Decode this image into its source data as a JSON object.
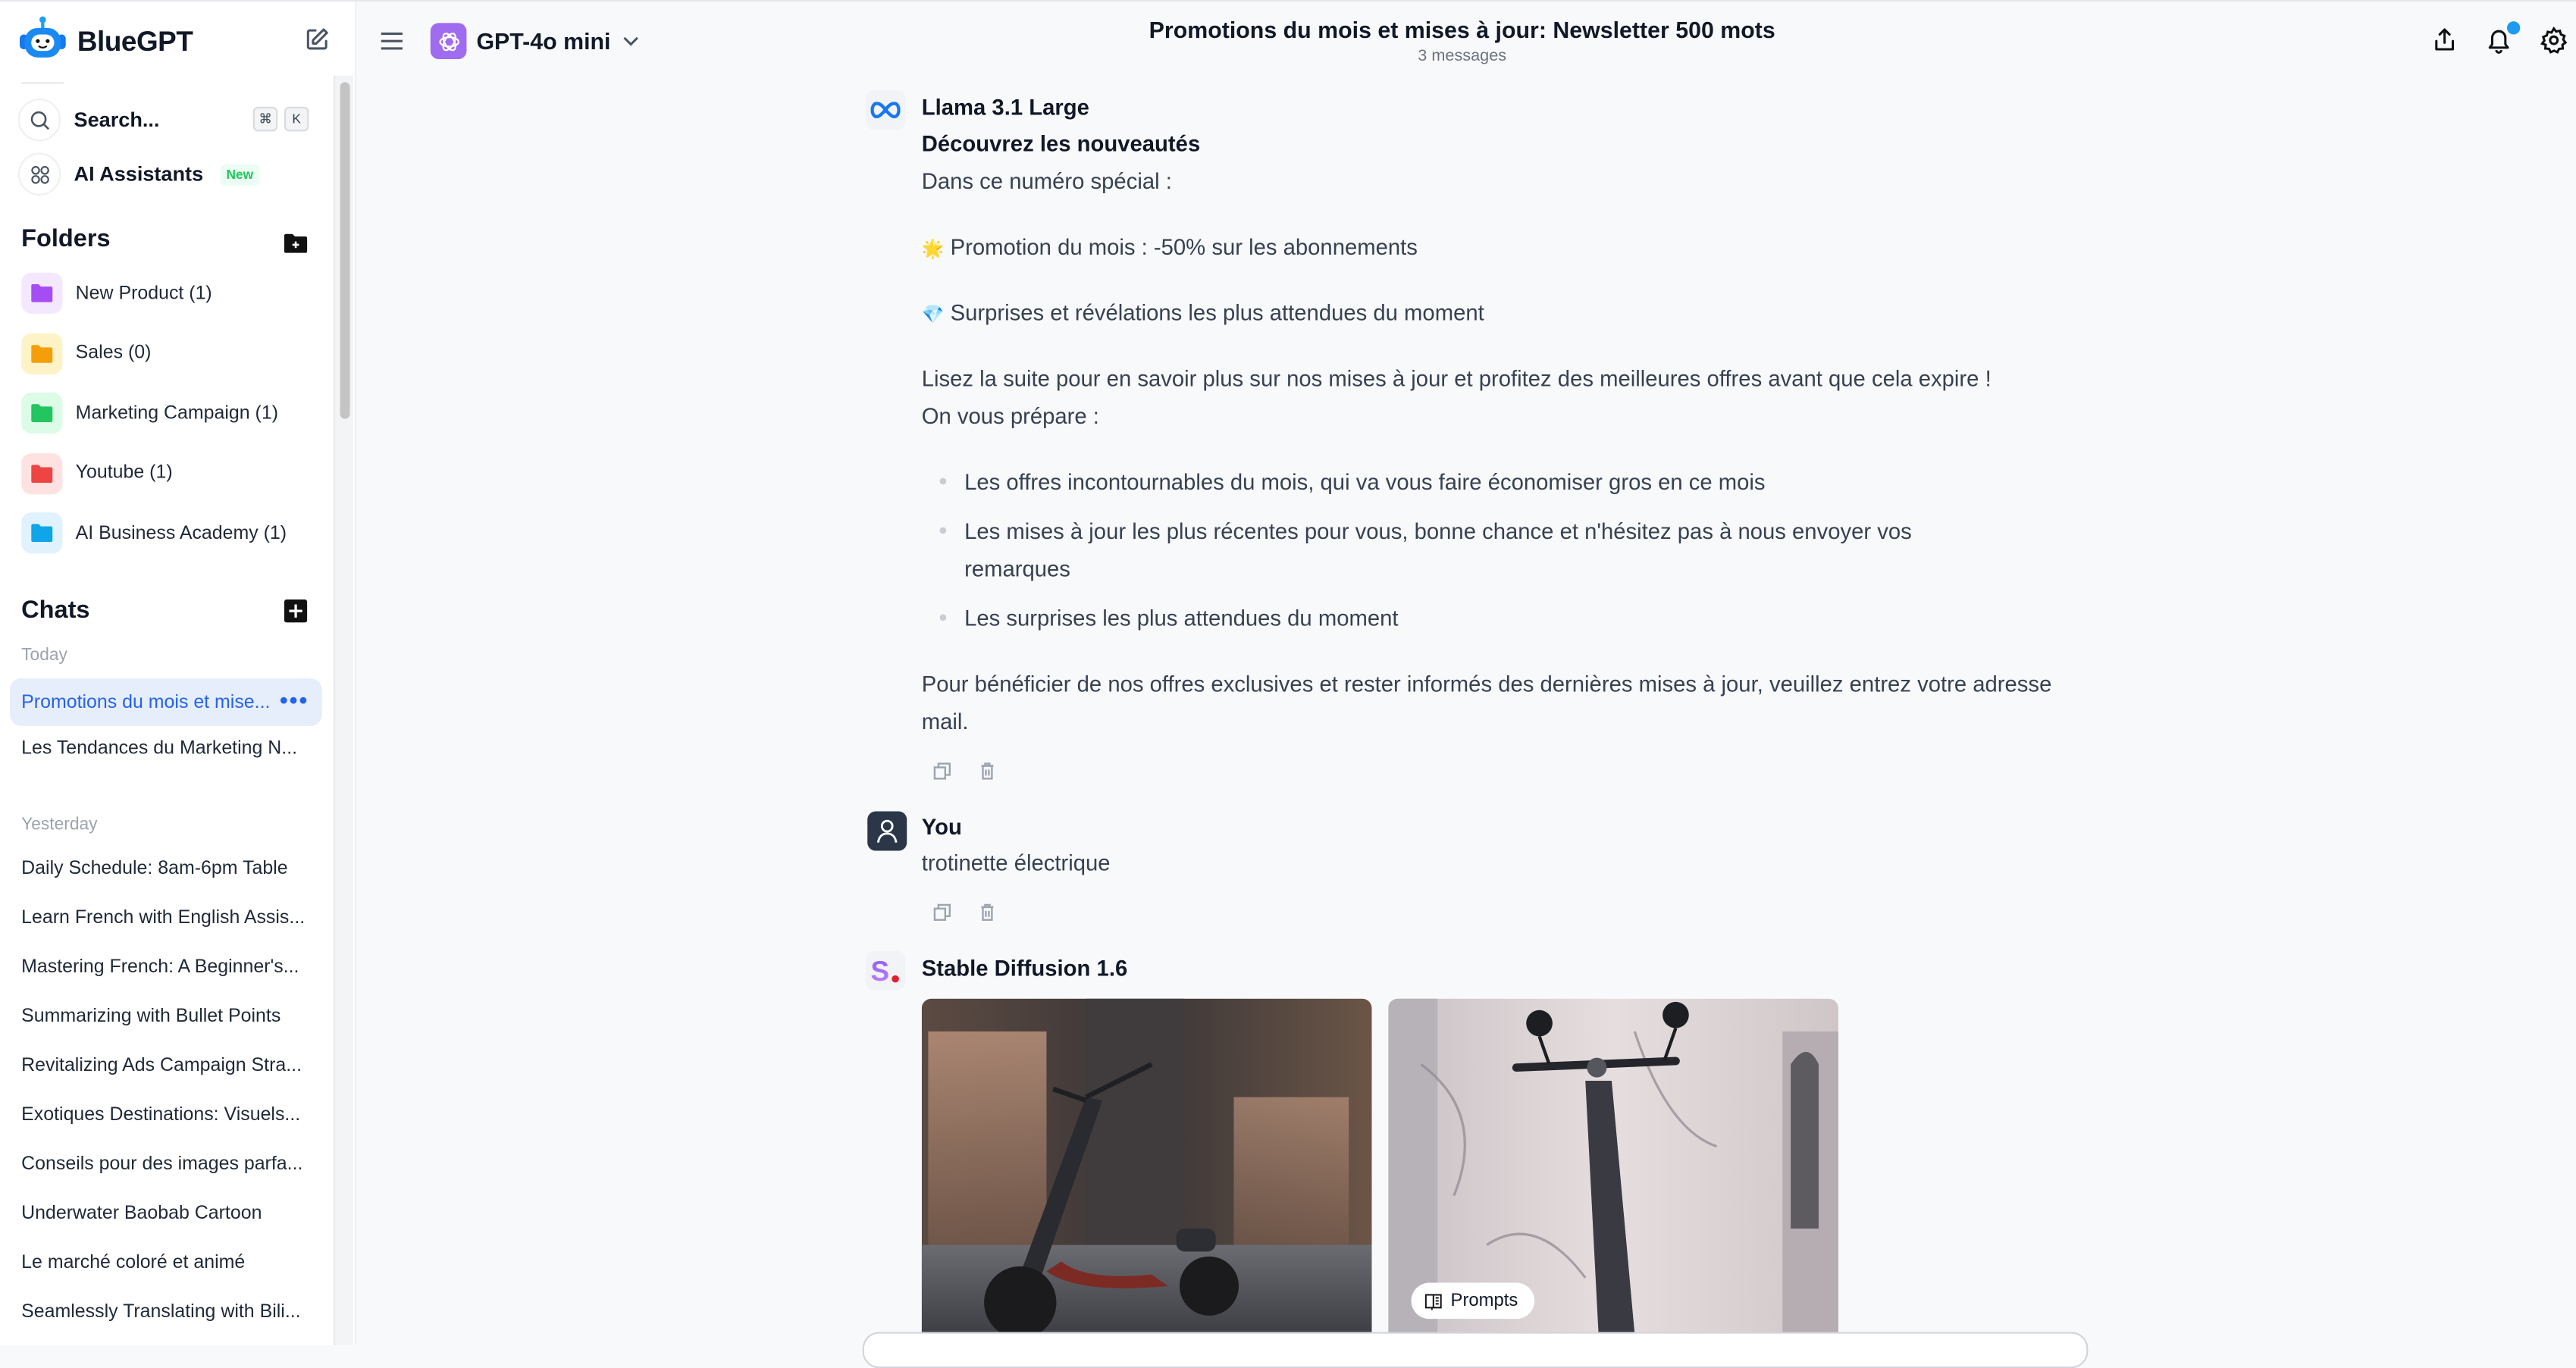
{
  "app": {
    "name": "BlueGPT",
    "logo_icon": "robot-head-icon",
    "new_chat_icon": "edit-icon"
  },
  "sidebar": {
    "search": {
      "label": "Search...",
      "shortcut_keys": [
        "⌘",
        "K"
      ]
    },
    "assistants": {
      "label": "AI Assistants",
      "badge": "New"
    },
    "folders_title": "Folders",
    "folders": [
      {
        "label": "New Product (1)",
        "color": "#a64cf5",
        "bg": "#f3e8ff"
      },
      {
        "label": "Sales (0)",
        "color": "#f59e0b",
        "bg": "#fef3c7"
      },
      {
        "label": "Marketing Campaign (1)",
        "color": "#22c55e",
        "bg": "#dcfce7"
      },
      {
        "label": "Youtube (1)",
        "color": "#ef4444",
        "bg": "#fee2e2"
      },
      {
        "label": "AI Business Academy (1)",
        "color": "#0ea5e9",
        "bg": "#e0f2fe"
      }
    ],
    "chats_title": "Chats",
    "groups": [
      {
        "label": "Today",
        "items": [
          {
            "label": "Promotions du mois et mise...",
            "active": true
          },
          {
            "label": "Les Tendances du Marketing N..."
          }
        ]
      },
      {
        "label": "Yesterday",
        "items": [
          {
            "label": "Daily Schedule: 8am-6pm Table"
          },
          {
            "label": "Learn French with English Assis..."
          },
          {
            "label": "Mastering French: A Beginner's..."
          },
          {
            "label": "Summarizing with Bullet Points"
          },
          {
            "label": "Revitalizing Ads Campaign Stra..."
          },
          {
            "label": "Exotiques Destinations: Visuels..."
          },
          {
            "label": "Conseils pour des images parfa..."
          },
          {
            "label": "Underwater Baobab Cartoon"
          },
          {
            "label": "Le marché coloré et animé"
          },
          {
            "label": "Seamlessly Translating with Bili..."
          }
        ]
      }
    ],
    "active_color": "#2563eb",
    "active_bg": "#e6eefb"
  },
  "header": {
    "model": "GPT-4o mini",
    "title": "Promotions du mois et mises à jour: Newsletter 500 mots",
    "subtitle": "3 messages",
    "icons": [
      "share-icon",
      "bell-icon",
      "settings-icon"
    ],
    "notification_dot_color": "#1d9bf0"
  },
  "messages": [
    {
      "author": "Llama 3.1 Large",
      "avatar_icon": "meta-logo-icon",
      "heading": "Découvrez les nouveautés",
      "intro": "Dans ce numéro spécial :",
      "highlights": [
        {
          "emoji": "🌟",
          "text": "Promotion du mois : -50% sur les abonnements"
        },
        {
          "emoji": "💎",
          "text": "Surprises et révélations les plus attendues du moment"
        }
      ],
      "paragraph_1": "Lisez la suite pour en savoir plus sur nos mises à jour et profitez des meilleures offres avant que cela expire !",
      "paragraph_2": "On vous prépare :",
      "bullets": [
        "Les offres incontournables du mois, qui va vous faire économiser gros en ce mois",
        "Les mises à jour les plus récentes pour vous, bonne chance et n'hésitez pas à nous envoyer vos remarques",
        "Les surprises les plus attendues du moment"
      ],
      "closing": "Pour bénéficier de nos offres exclusives et rester informés des dernières mises à jour, veuillez entrez votre adresse mail."
    },
    {
      "author": "You",
      "avatar_icon": "user-icon",
      "text": "trotinette électrique"
    },
    {
      "author": "Stable Diffusion 1.6",
      "avatar_icon": "stable-diffusion-logo-icon",
      "images": [
        {
          "alt": "electric scooter in front of a shop window at dusk"
        },
        {
          "alt": "electric scooter leaning against a marble wall"
        }
      ],
      "prompts_label": "Prompts"
    }
  ]
}
